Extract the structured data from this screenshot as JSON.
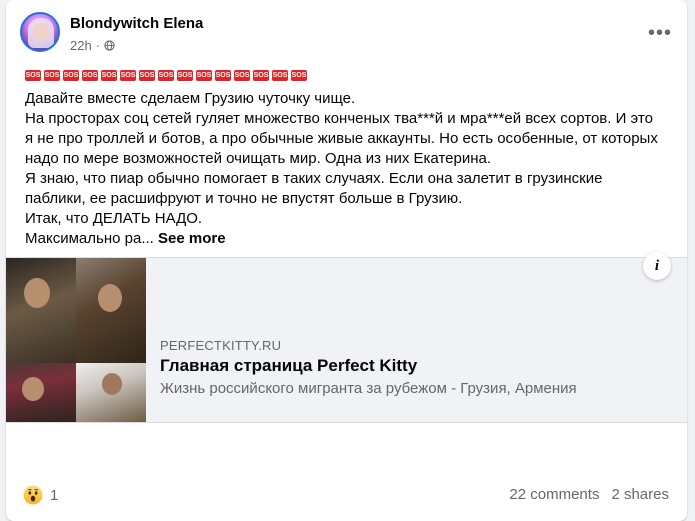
{
  "post": {
    "author": "Blondywitch Elena",
    "time": "22h",
    "sos_badge": "SOS",
    "sos_count": 15,
    "lines": [
      "Давайте вместе сделаем Грузию чуточку чище.",
      "На просторах соц сетей гуляет множество конченых тва***й и мра***ей всех сортов. И это я не про троллей и ботов, а про обычные живые аккаунты. Но есть особенные, от которых надо по мере возможностей очищать мир. Одна из них Екатерина.",
      "Я знаю, что пиар обычно помогает в таких случаях. Если она залетит в грузинские паблики, ее расшифруют и точно не впустят больше в Грузию.",
      "Итак, что ДЕЛАТЬ НАДО."
    ],
    "truncated_line": "Максимально ра...",
    "see_more": "See more"
  },
  "link_preview": {
    "domain": "PERFECTKITTY.RU",
    "title": "Главная страница Perfect Kitty",
    "description": "Жизнь российского мигранта за рубежом - Грузия, Армения",
    "info_label": "i"
  },
  "footer": {
    "reaction_count": "1",
    "comments": "22 comments",
    "shares": "2 shares"
  },
  "icons": {
    "more": "more-horizontal-icon",
    "privacy": "globe-icon",
    "reaction": "wow-icon"
  },
  "colors": {
    "sos_red": "#e02427",
    "text": "#050505",
    "secondary": "#65676b"
  }
}
